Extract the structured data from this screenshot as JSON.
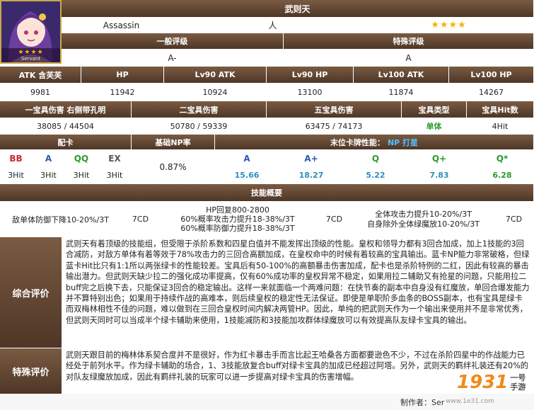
{
  "servant": {
    "name": "武则天",
    "class": "Assassin",
    "attribute": "人",
    "stars": "★★★★",
    "portrait_label": "Servant",
    "portrait_stars": "★★★★"
  },
  "ratings": {
    "general_label": "一般评级",
    "general_value": "A-",
    "special_label": "特殊评级",
    "special_value": "A"
  },
  "stats_headers": [
    "ATK 含芙芙",
    "HP",
    "Lv90 ATK",
    "Lv90 HP",
    "Lv100 ATK",
    "Lv100 HP"
  ],
  "stats_values": [
    "9981",
    "11942",
    "10924",
    "13100",
    "11874",
    "14267"
  ],
  "np_headers": {
    "np1": "一宝具伤害 右侧带孔明",
    "np2": "二宝具伤害",
    "np5": "五宝具伤害",
    "np_type": "宝具类型",
    "np_hits": "宝具Hit数"
  },
  "np_values": {
    "np1": "38085 / 44504",
    "np2": "50780 / 59339",
    "np5": "63475 / 74173",
    "np_type": "单体",
    "np_hits": "4Hit"
  },
  "cards_header": "配卡",
  "np_rate_header": "基础NP率",
  "star_perf_header": "末位卡牌性能：",
  "star_perf_np": "NP 打星",
  "cards": [
    {
      "label": "BB",
      "hits": "3Hit"
    },
    {
      "label": "A",
      "hits": "3Hit"
    },
    {
      "label": "QQ",
      "hits": "3Hit"
    },
    {
      "label": "EX",
      "hits": "3Hit"
    }
  ],
  "np_rate": "0.87%",
  "card_perf": [
    {
      "label": "A",
      "value": "15.66"
    },
    {
      "label": "A+",
      "value": "18.27"
    },
    {
      "label": "Q",
      "value": "5.22"
    },
    {
      "label": "Q+",
      "value": "7.83"
    },
    {
      "label": "Q*",
      "value": "6.28"
    }
  ],
  "skills_header": "技能概要",
  "skills": [
    {
      "text": "敌单体防御下降10-20%/3T",
      "cd": "7CD"
    },
    {
      "text_lines": [
        "HP回复800-2800",
        "60%概率攻击力提升18-38%/3T",
        "60%概率防御力提升18-38%/3T"
      ],
      "cd": "7CD"
    },
    {
      "text_lines": [
        "全体攻击力提升10-20%/3T",
        "自身除外全体绿魔放10-20%/3T"
      ],
      "cd": "7CD"
    }
  ],
  "overall": {
    "label": "综合评价",
    "text": "武则天有着顶级的技能组，但受限于杀阶系数和四星白值并不能发挥出顶级的性能。皇权和领导力都有3回合加成，加上1技能的3回合减防，对敌方单体有着等效于78%攻击力的三回合高额加成，在皇权命中的时候有着较高的宝具输出。蓝卡NP能力非常破格，但绿蓝卡Hit比只有1:1所以两张绿卡的性能较差。宝具后有50-100%的高额暴击伤害加成，配卡也是杀阶特例的二红，因此有较高的暴击输出潜力。但武则天缺少拉二的强化成功率提高，仅有60%成功率的皇权异常不稳定，如果用拉二辅助又有抢星的问题，只能用拉二buff完之后换下去，只能保证3回合的稳定输出。这样一来就面临一个两难问题：在快节奏的副本中自身没有红魔放，单回合爆发能力并不算特别出色；如果用于持续作战的高难本，则后续皇权的稳定性无法保证。即使是单职阶多血条的BOSS副本，也有宝具是绿卡而双梅林相性不佳的问题，难以做到在三回合皇权时间内解决两管HP。因此，单纯的把武则天作为一个输出来使用并不是非常优秀，但武则天同时可以当成半个绿卡辅助来使用，1技能减防和3技能加攻群体绿魔放可以有效提高队友绿卡宝具的输出。"
  },
  "special": {
    "label": "特殊评价",
    "text": "武则天跟目前的梅林体系契合度并不是很好，作为红卡暴击手而言比起王哈桑各方面都要逊色不少，不过在杀阶四星中的作战能力已经处于前列水平。作为绿卡辅助的场合，1、3技能放复合buff对绿卡宝具的加成已经超过阿塔。另外，武则天的羁绊礼装还有20%的对队友绿魔放加成，因此有羁绊礼装的玩家可以进一步提高对绿卡宝具的伤害增幅。"
  },
  "footer": {
    "author_label": "制作者：",
    "author": "Ser",
    "watermark_url": "www.1e31.com",
    "logo_text": "1931",
    "logo_sub1": "一号",
    "logo_sub2": "手游"
  }
}
